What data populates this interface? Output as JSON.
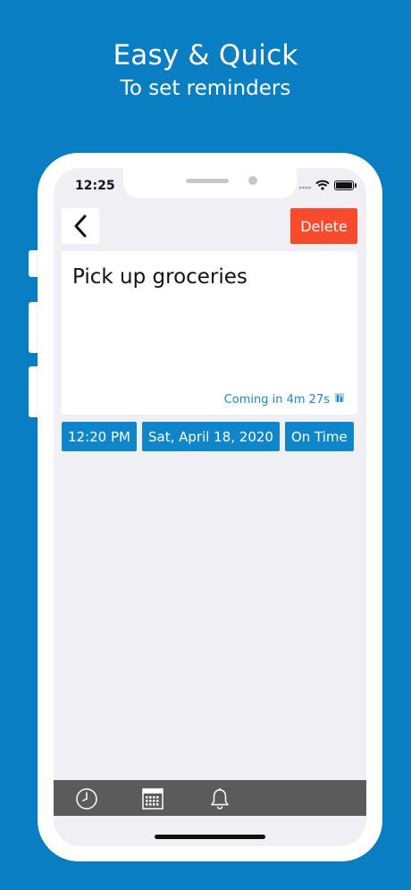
{
  "headline": {
    "title": "Easy & Quick",
    "subtitle": "To set reminders"
  },
  "status_bar": {
    "time": "12:25"
  },
  "toolbar": {
    "back_icon": "chevron-left-icon",
    "delete_label": "Delete"
  },
  "reminder": {
    "text": "Pick up groceries",
    "countdown": "Coming in 4m 27s",
    "countdown_icon": "hourglass-icon"
  },
  "chips": {
    "time": "12:20 PM",
    "date": "Sat, April 18, 2020",
    "status": "On Time"
  },
  "tabbar": {
    "items": [
      "clock-icon",
      "calendar-icon",
      "bell-icon"
    ]
  },
  "colors": {
    "background": "#0a7ec2",
    "delete": "#f84a2c",
    "chip": "#0e86c9",
    "tabbar": "#5b5b5b"
  }
}
